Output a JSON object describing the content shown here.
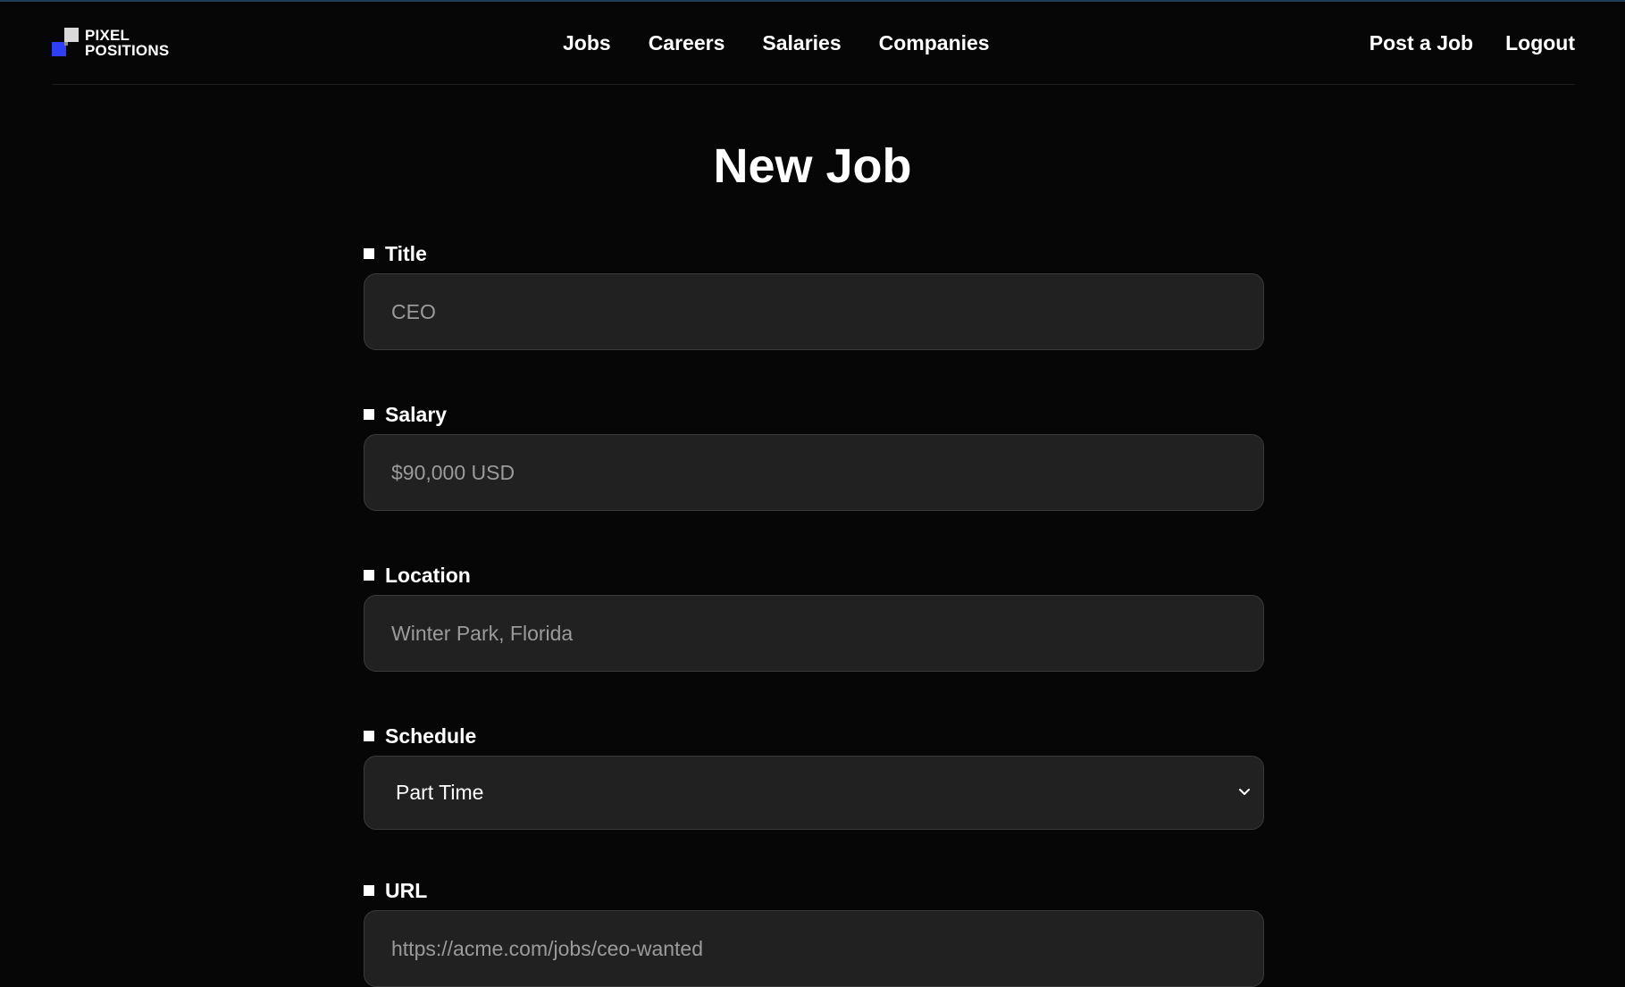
{
  "brand": {
    "line1": "PIXEL",
    "line2": "POSITIONS",
    "mark_colors": {
      "blue": "#2f3ff5",
      "light": "#d9d9d9"
    }
  },
  "nav": {
    "links": [
      "Jobs",
      "Careers",
      "Salaries",
      "Companies"
    ],
    "post_job": "Post a Job",
    "logout": "Logout"
  },
  "page": {
    "title": "New Job"
  },
  "form": {
    "title": {
      "label": "Title",
      "placeholder": "CEO"
    },
    "salary": {
      "label": "Salary",
      "placeholder": "$90,000 USD"
    },
    "location": {
      "label": "Location",
      "placeholder": "Winter Park, Florida"
    },
    "schedule": {
      "label": "Schedule",
      "selected": "Part Time",
      "icon": "chevron-down-icon"
    },
    "url": {
      "label": "URL",
      "placeholder": "https://acme.com/jobs/ceo-wanted"
    }
  },
  "colors": {
    "background": "#060606",
    "field_bg": "#212121",
    "placeholder": "#9b9b9b",
    "text": "#ffffff"
  }
}
